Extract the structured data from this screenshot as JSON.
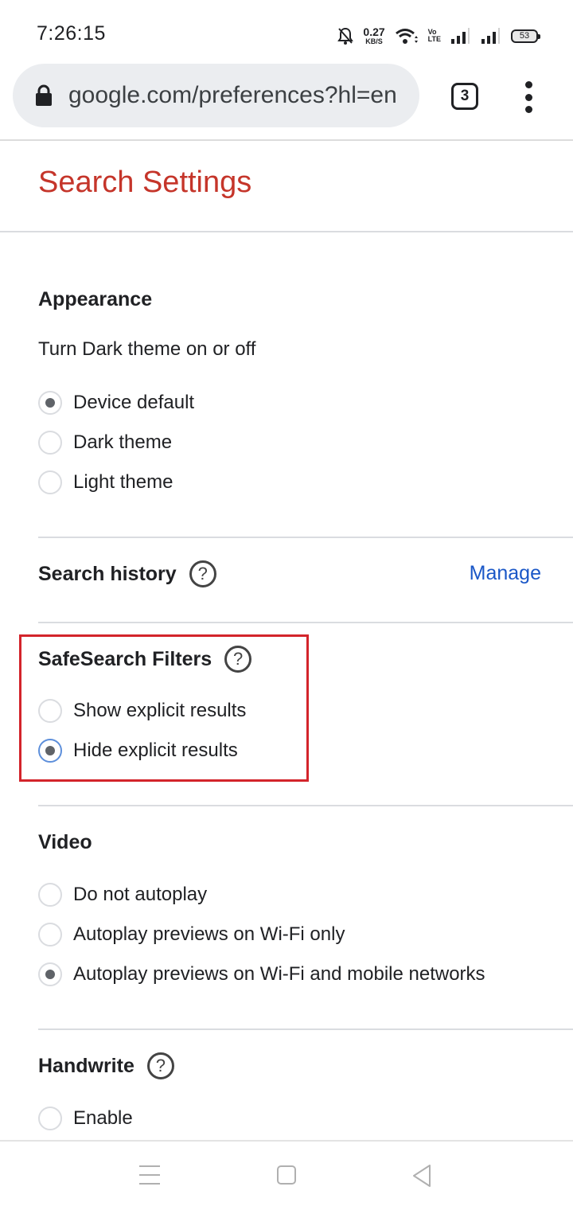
{
  "status_bar": {
    "time": "7:26:15",
    "net_speed_value": "0.27",
    "net_speed_unit": "KB/S",
    "volte_top": "Vo",
    "volte_bottom": "LTE",
    "battery": "53",
    "icons": [
      "notifications-off-icon",
      "wifi-icon",
      "volte-icon",
      "signal-icon",
      "signal-icon",
      "battery-icon"
    ]
  },
  "browser": {
    "url": "google.com/preferences?hl=en",
    "tab_count": "3",
    "icons": [
      "lock-icon",
      "tabs-icon",
      "more-vert-icon"
    ]
  },
  "page": {
    "title": "Search Settings",
    "title_color": "#c5352a",
    "sections": {
      "appearance": {
        "heading": "Appearance",
        "subtitle": "Turn Dark theme on or off",
        "options": [
          {
            "label": "Device default",
            "checked": true
          },
          {
            "label": "Dark theme",
            "checked": false
          },
          {
            "label": "Light theme",
            "checked": false
          }
        ]
      },
      "search_history": {
        "heading": "Search history",
        "link": "Manage",
        "link_color": "#1a57c7"
      },
      "safesearch": {
        "heading": "SafeSearch Filters",
        "highlight_color": "#d3242b",
        "options": [
          {
            "label": "Show explicit results",
            "checked": false
          },
          {
            "label": "Hide explicit results",
            "checked": true
          }
        ]
      },
      "video": {
        "heading": "Video",
        "options": [
          {
            "label": "Do not autoplay",
            "checked": false
          },
          {
            "label": "Autoplay previews on Wi-Fi only",
            "checked": false
          },
          {
            "label": "Autoplay previews on Wi-Fi and mobile networks",
            "checked": true
          }
        ]
      },
      "handwrite": {
        "heading": "Handwrite",
        "options": [
          {
            "label": "Enable",
            "checked": false
          }
        ]
      }
    }
  },
  "nav_bar": {
    "icons": [
      "recents-icon",
      "home-icon",
      "back-icon"
    ]
  }
}
